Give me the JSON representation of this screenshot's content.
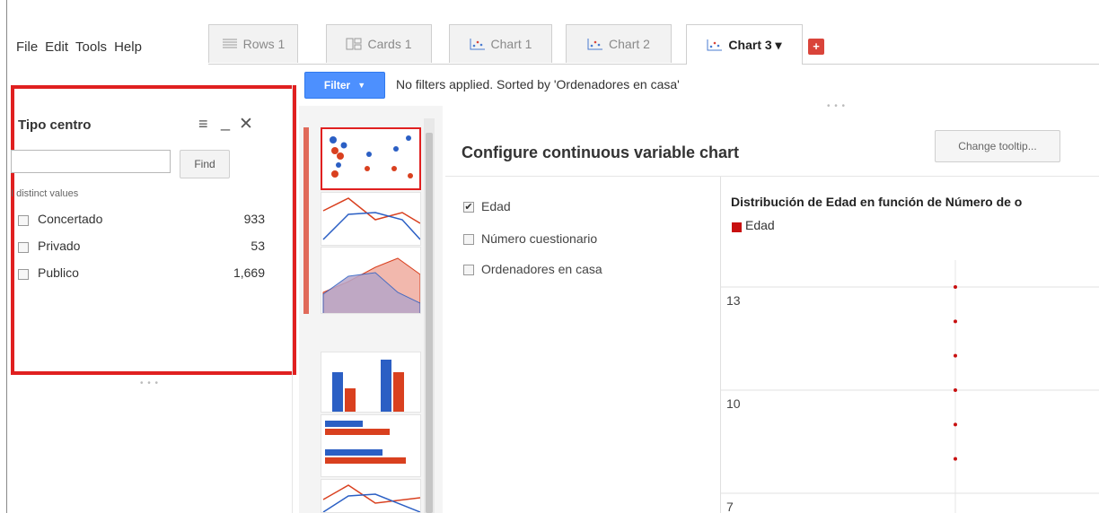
{
  "menu": {
    "items": [
      "File",
      "Edit",
      "Tools",
      "Help"
    ]
  },
  "tabs": [
    {
      "label": "Rows 1",
      "icon": "rows-icon"
    },
    {
      "label": "Cards 1",
      "icon": "cards-icon"
    },
    {
      "label": "Chart 1",
      "icon": "chart-icon"
    },
    {
      "label": "Chart 2",
      "icon": "chart-icon"
    },
    {
      "label": "Chart 3 ▾",
      "icon": "chart-icon",
      "active": true
    }
  ],
  "add_tab_label": "+",
  "toolbar": {
    "filter_label": "Filter",
    "status": "No filters applied. Sorted by 'Ordenadores en casa'"
  },
  "facet": {
    "title": "Tipo centro",
    "search_placeholder": "",
    "find_label": "Find",
    "distinct_label": "I distinct values",
    "items": [
      {
        "label": "Concertado",
        "count": "933"
      },
      {
        "label": "Privado",
        "count": "53"
      },
      {
        "label": "Publico",
        "count": "1,669"
      }
    ]
  },
  "config": {
    "title": "Configure continuous variable chart",
    "tooltip_label": "Change tooltip...",
    "variables": [
      {
        "label": "Edad",
        "checked": true
      },
      {
        "label": "Número cuestionario",
        "checked": false
      },
      {
        "label": "Ordenadores en casa",
        "checked": false
      }
    ]
  },
  "chart_data": {
    "type": "scatter",
    "title": "Distribución de Edad en función de Número de o",
    "legend": [
      "Edad"
    ],
    "color": "#c81010",
    "ytick_labels": [
      "13",
      "10",
      "7"
    ],
    "series": [
      {
        "name": "Edad",
        "x": [
          0,
          0,
          0,
          0,
          0,
          0
        ],
        "y": [
          13,
          12,
          11,
          10,
          9,
          8
        ]
      }
    ]
  }
}
